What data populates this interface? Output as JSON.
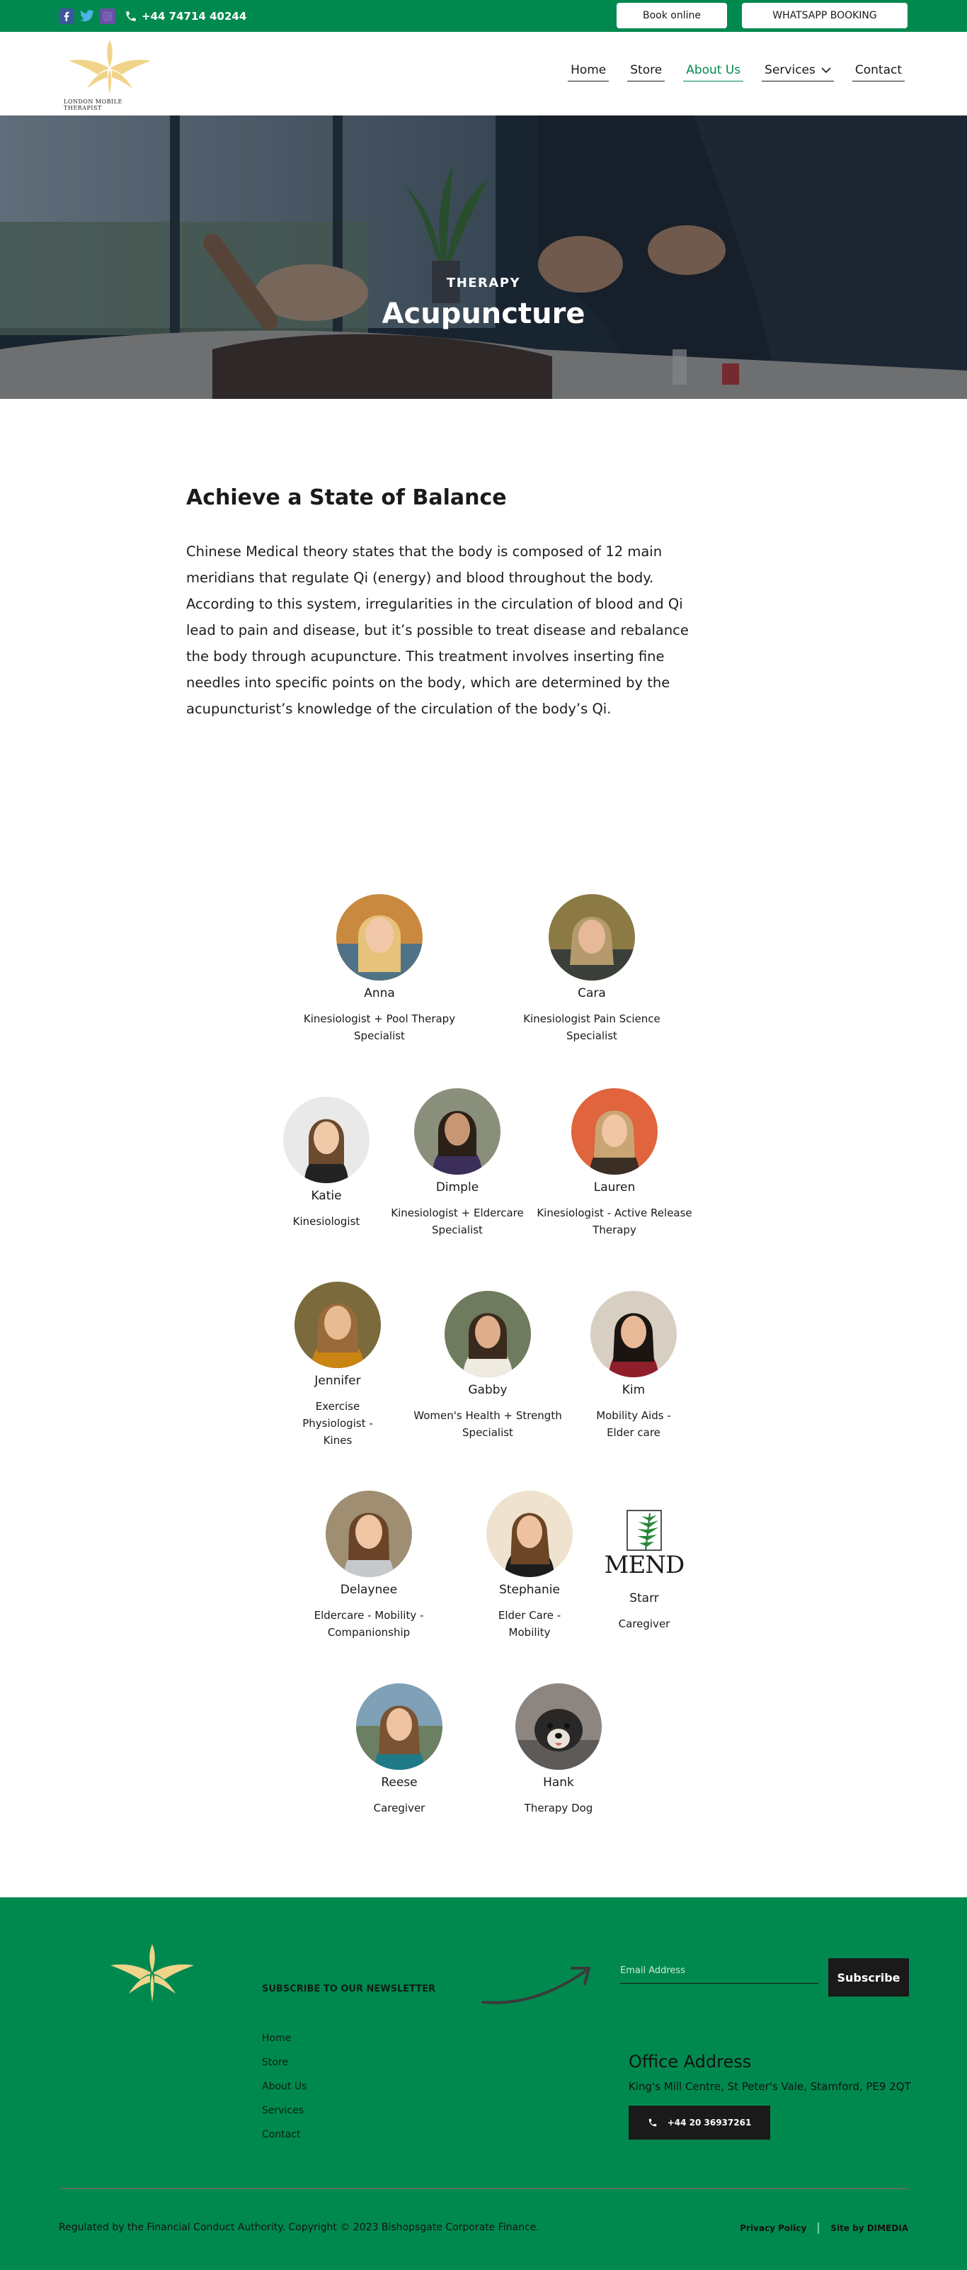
{
  "topbar": {
    "phone": "+44 74714 40244",
    "book_label": "Book online",
    "whatsapp_label": "WHATSAPP BOOKING"
  },
  "brand": {
    "logo_text": "LONDON MOBILE THERAPIST",
    "accent": "#00894f"
  },
  "nav": {
    "items": [
      {
        "label": "Home"
      },
      {
        "label": "Store"
      },
      {
        "label": "About Us"
      },
      {
        "label": "Services"
      },
      {
        "label": "Contact"
      }
    ]
  },
  "hero": {
    "kicker": "THERAPY",
    "title": "Acupuncture"
  },
  "intro": {
    "heading": "Achieve a State of Balance",
    "body": "Chinese Medical theory states that the body is composed of 12 main meridians that regulate Qi (energy) and blood throughout the body. According to this system, irregularities in the circulation of blood and Qi lead to pain and disease, but it’s possible to treat disease and rebalance the body through acupuncture. This treatment involves inserting fine needles into specific points on the body, which are determined by the acupuncturist’s knowledge of the circulation of the body’s Qi."
  },
  "team": {
    "members": [
      {
        "name": "Anna",
        "role": "Kinesiologist + Pool Therapy Specialist"
      },
      {
        "name": "Cara",
        "role": "Kinesiologist Pain Science Specialist"
      },
      {
        "name": "Katie",
        "role": "Kinesiologist"
      },
      {
        "name": "Dimple",
        "role": "Kinesiologist + Eldercare Specialist"
      },
      {
        "name": "Lauren",
        "role": "Kinesiologist - Active Release Therapy"
      },
      {
        "name": "Jennifer",
        "role": "Exercise Physiologist - Kines"
      },
      {
        "name": "Gabby",
        "role": "Women's Health + Strength Specialist"
      },
      {
        "name": "Kim",
        "role": "Mobility Aids - Elder care"
      },
      {
        "name": "Delaynee",
        "role": "Eldercare - Mobility - Companionship"
      },
      {
        "name": "Stephanie",
        "role": "Elder Care - Mobility"
      },
      {
        "name": "Starr",
        "role": "Caregiver",
        "logo_word": "MEND"
      },
      {
        "name": "Reese",
        "role": "Caregiver"
      },
      {
        "name": "Hank",
        "role": "Therapy Dog"
      }
    ]
  },
  "footer": {
    "newsletter_label": "SUBSCRIBE TO OUR NEWSLETTER",
    "email_placeholder": "Email Address",
    "subscribe_label": "Subscribe",
    "links": [
      {
        "label": "Home"
      },
      {
        "label": "Store"
      },
      {
        "label": "About Us"
      },
      {
        "label": "Services"
      },
      {
        "label": "Contact"
      }
    ],
    "office_title": "Office Address",
    "office_address": "King's Mill Centre, St Peter's Vale, Stamford, PE9 2QT",
    "office_phone": "+44 20 36937261",
    "copyright": "Regulated by the Financial Conduct Authority. Copyright © 2023 Bishopsgate Corporate Finance.",
    "privacy_label": "Privacy Policy",
    "site_by_label": "Site by DIMEDIA"
  }
}
